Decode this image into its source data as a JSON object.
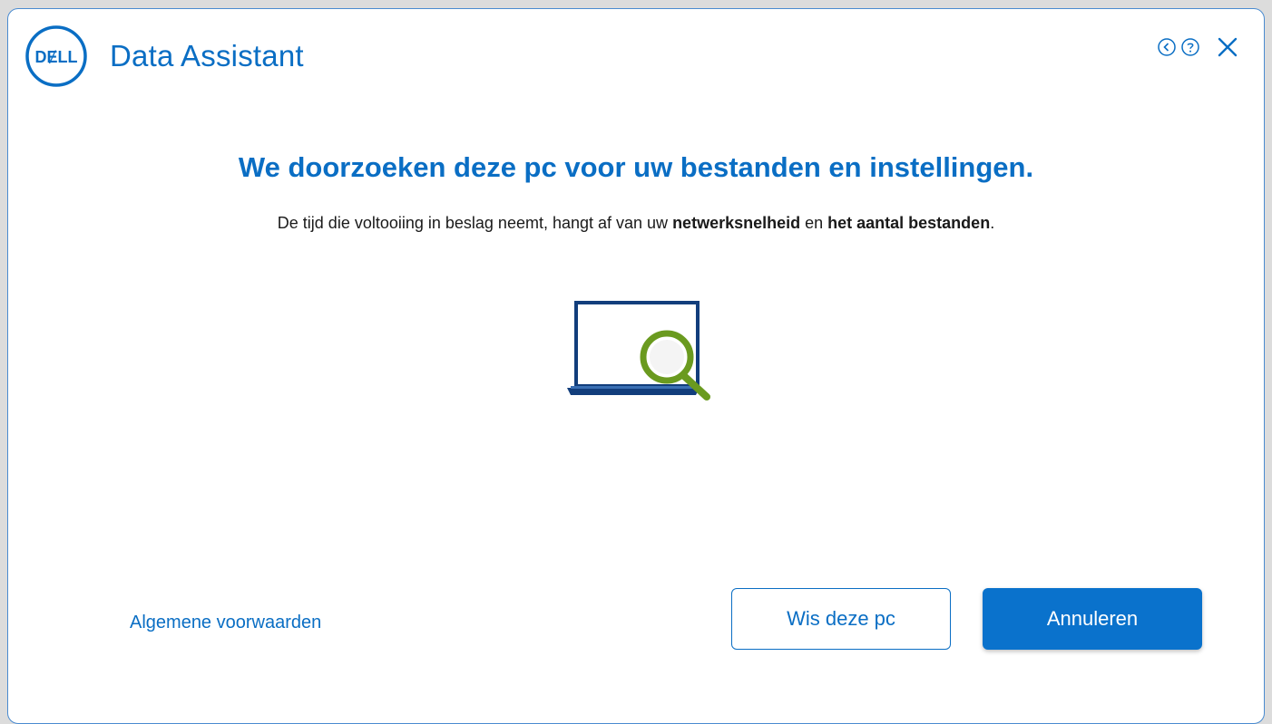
{
  "window": {
    "brand_logo_text": "DELL",
    "title": "Data Assistant",
    "icons": {
      "back": "chevron-left-circle-icon",
      "help": "question-circle-icon",
      "close": "close-icon"
    }
  },
  "main": {
    "headline": "We doorzoeken deze pc voor uw bestanden en instellingen.",
    "subline": {
      "part1": "De tijd die voltooiing in beslag neemt, hangt af van uw ",
      "bold1": "netwerksnelheid",
      "part2": " en ",
      "bold2": "het aantal bestanden",
      "part3": "."
    },
    "illustration": "laptop-search-icon"
  },
  "footer": {
    "terms_link": "Algemene voorwaarden",
    "wipe_button": "Wis deze pc",
    "cancel_button": "Annuleren"
  },
  "colors": {
    "accent": "#0a6ec4",
    "illustration_green": "#6a9a1f",
    "illustration_navy": "#123e7c"
  }
}
